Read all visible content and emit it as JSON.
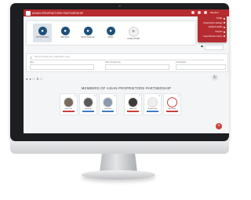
{
  "app": {
    "title": "ASIAN PROPRIETORS PARTNERSHIP"
  },
  "topbar": {
    "user_name": "Member"
  },
  "account_menu": [
    {
      "label": "Profile"
    },
    {
      "label": "Organization settings"
    },
    {
      "label": "Updated details"
    },
    {
      "label": "Support"
    },
    {
      "label": "Login Browser Admin"
    }
  ],
  "nav": [
    {
      "label": "All Directories",
      "icon": "users-icon"
    },
    {
      "label": "Members",
      "icon": "person-icon"
    },
    {
      "label": "Event Sources",
      "icon": "calendar-icon"
    },
    {
      "label": "Globe",
      "icon": "car-icon"
    },
    {
      "label": "Create Profile",
      "icon": "plus-icon"
    }
  ],
  "filters": {
    "search_placeholder": "Filter by member name, organisation, or tag",
    "fields": [
      {
        "label": "Sites"
      },
      {
        "label": "Select Groups here"
      },
      {
        "label": "Incorporated"
      }
    ]
  },
  "section_title": "MEMBERS OF ASIAN PROPRIETORS PARTNERSHIP",
  "members": [
    {
      "name": "Vincent Lim",
      "badge": "Director",
      "avatar_color": "#7a6a5c"
    },
    {
      "name": "Rahul Iyer",
      "badge": "Member",
      "avatar_color": "#5a5a5a"
    },
    {
      "name": "Daniel Kim",
      "badge": "Member",
      "avatar_color": "#8a9bb0"
    },
    {
      "name": "Sophia Ong",
      "badge": "Director",
      "avatar_color": "#3f3a3a"
    },
    {
      "name": "Member Name",
      "badge": "Member",
      "avatar_color": "#eeeeee"
    },
    {
      "name": "Amy Huang",
      "badge": "Director",
      "avatar_color": "#d2413b"
    }
  ]
}
